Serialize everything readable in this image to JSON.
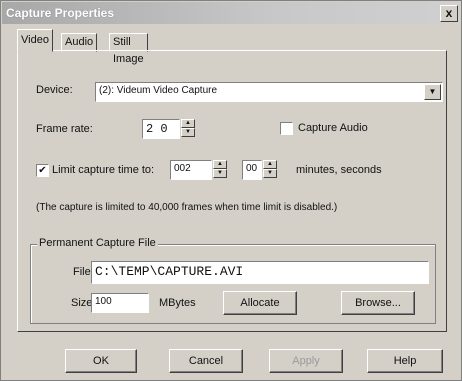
{
  "window": {
    "title": "Capture Properties",
    "close_glyph": "x"
  },
  "tabs": [
    "Video",
    "Audio",
    "Still Image"
  ],
  "device": {
    "label": "Device:",
    "value": "(2): Videum Video Capture"
  },
  "frame_rate": {
    "label": "Frame rate:",
    "value": "2 0"
  },
  "capture_audio": {
    "label": "Capture Audio",
    "checked": false
  },
  "limit": {
    "label": "Limit capture time to:",
    "checked": true,
    "minutes": "002",
    "seconds": "00",
    "units": "minutes, seconds"
  },
  "note": "(The capture is limited to 40,000 frames when time limit is disabled.)",
  "capture_file": {
    "group_title": "Permanent Capture File",
    "file_label": "File:",
    "file_value": "C:\\TEMP\\CAPTURE.AVI",
    "size_label": "Size:",
    "size_value": "100",
    "size_unit": "MBytes",
    "allocate": "Allocate",
    "browse": "Browse..."
  },
  "buttons": {
    "ok": "OK",
    "cancel": "Cancel",
    "apply": "Apply",
    "help": "Help"
  }
}
